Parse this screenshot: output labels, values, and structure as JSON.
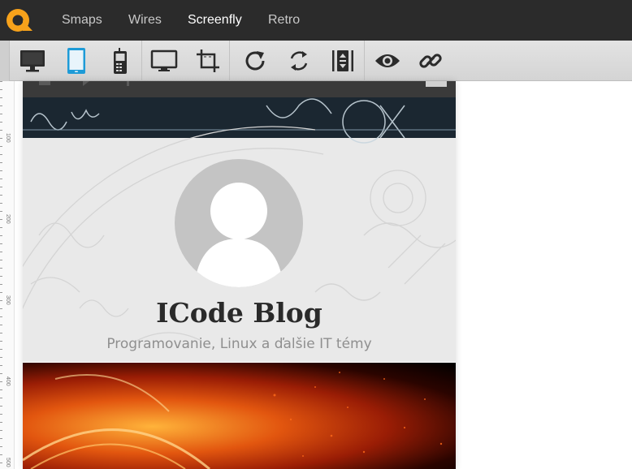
{
  "nav": {
    "items": [
      {
        "label": "Smaps",
        "active": false
      },
      {
        "label": "Wires",
        "active": false
      },
      {
        "label": "Screenfly",
        "active": true
      },
      {
        "label": "Retro",
        "active": false
      }
    ]
  },
  "toolbar": {
    "buttons": [
      {
        "icon": "desktop-icon",
        "active": false
      },
      {
        "icon": "tablet-icon",
        "active": true
      },
      {
        "icon": "mobile-phone-icon",
        "active": false
      },
      {
        "icon": "television-icon",
        "active": false
      },
      {
        "icon": "crop-icon",
        "active": false
      },
      {
        "icon": "refresh-icon",
        "active": false
      },
      {
        "icon": "rotate-icon",
        "active": false
      },
      {
        "icon": "scroll-icon",
        "active": false
      },
      {
        "icon": "eye-icon",
        "active": false
      },
      {
        "icon": "link-icon",
        "active": false
      }
    ]
  },
  "ruler": {
    "labels": [
      "100",
      "200",
      "300",
      "400",
      "500"
    ]
  },
  "site": {
    "title": "ICode Blog",
    "tagline": "Programovanie, Linux a ďalšie IT témy"
  },
  "colors": {
    "nav_bg": "#2b2b2b",
    "logo_orange": "#f7a21b",
    "active_blue": "#1e9bd7"
  }
}
